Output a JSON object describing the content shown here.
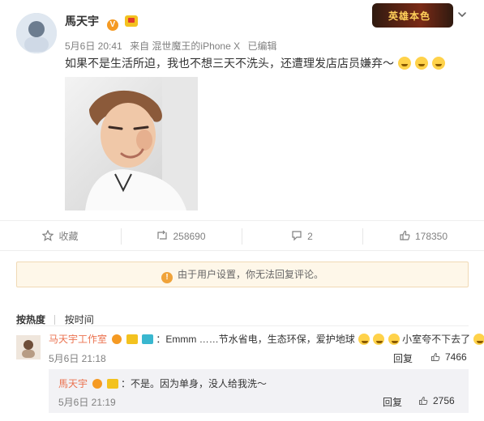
{
  "post": {
    "author": "馬天宇",
    "date": "5月6日 20:41",
    "source": "来自 混世魔王的iPhone X",
    "edited": "已编辑",
    "content": "如果不是生活所迫，我也不想三天不洗头，还遭理发店店员嫌弃～"
  },
  "actions": {
    "favorite": "收藏",
    "repost_count": "258690",
    "comment_count": "2",
    "like_count": "178350"
  },
  "notice": {
    "text": "由于用户设置，你无法回复评论。"
  },
  "sort": {
    "by_hot": "按热度",
    "by_time": "按时间"
  },
  "comments": [
    {
      "author": "马天宇工作室",
      "text": "：Emmm ……节水省电，生态环保，爱护地球",
      "text_suffix": "小室夸不下去了",
      "time": "5月6日 21:18",
      "reply": "回复",
      "likes": "7466"
    },
    {
      "author": "馬天宇",
      "text": "：不是。因为单身，没人给我洗～",
      "time": "5月6日 21:19",
      "reply": "回复",
      "likes": "2756"
    }
  ],
  "banner": {
    "text": "英雄本色"
  }
}
